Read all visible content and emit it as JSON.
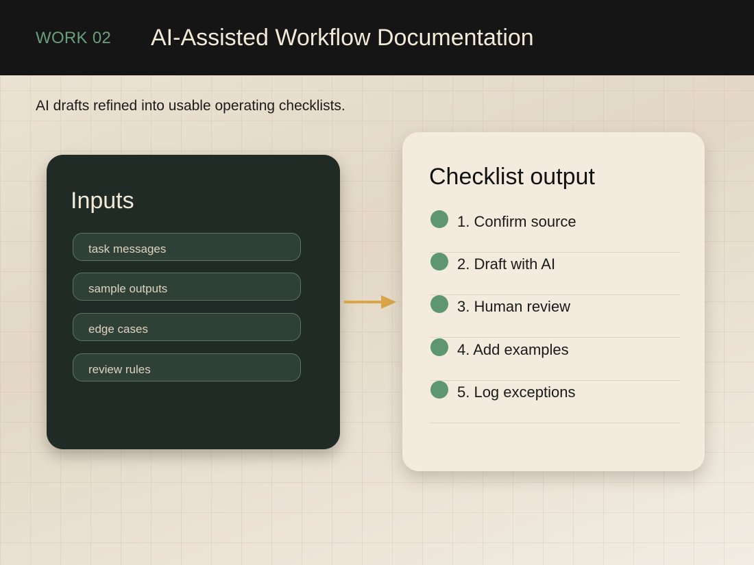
{
  "header": {
    "work_label": "WORK 02",
    "title": "AI-Assisted Workflow Documentation"
  },
  "subtitle": "AI drafts refined into usable operating checklists.",
  "inputs": {
    "title": "Inputs",
    "items": [
      "task messages",
      "sample outputs",
      "edge cases",
      "review rules"
    ]
  },
  "checklist": {
    "title": "Checklist output",
    "items": [
      "1. Confirm source",
      "2. Draft with AI",
      "3. Human review",
      "4. Add examples",
      "5. Log exceptions"
    ]
  },
  "colors": {
    "accent_green": "#5e9671",
    "arrow_gold": "#d9a548",
    "dark_card": "#212b25",
    "light_card": "#f3ebdd",
    "header_bg": "#141514"
  }
}
